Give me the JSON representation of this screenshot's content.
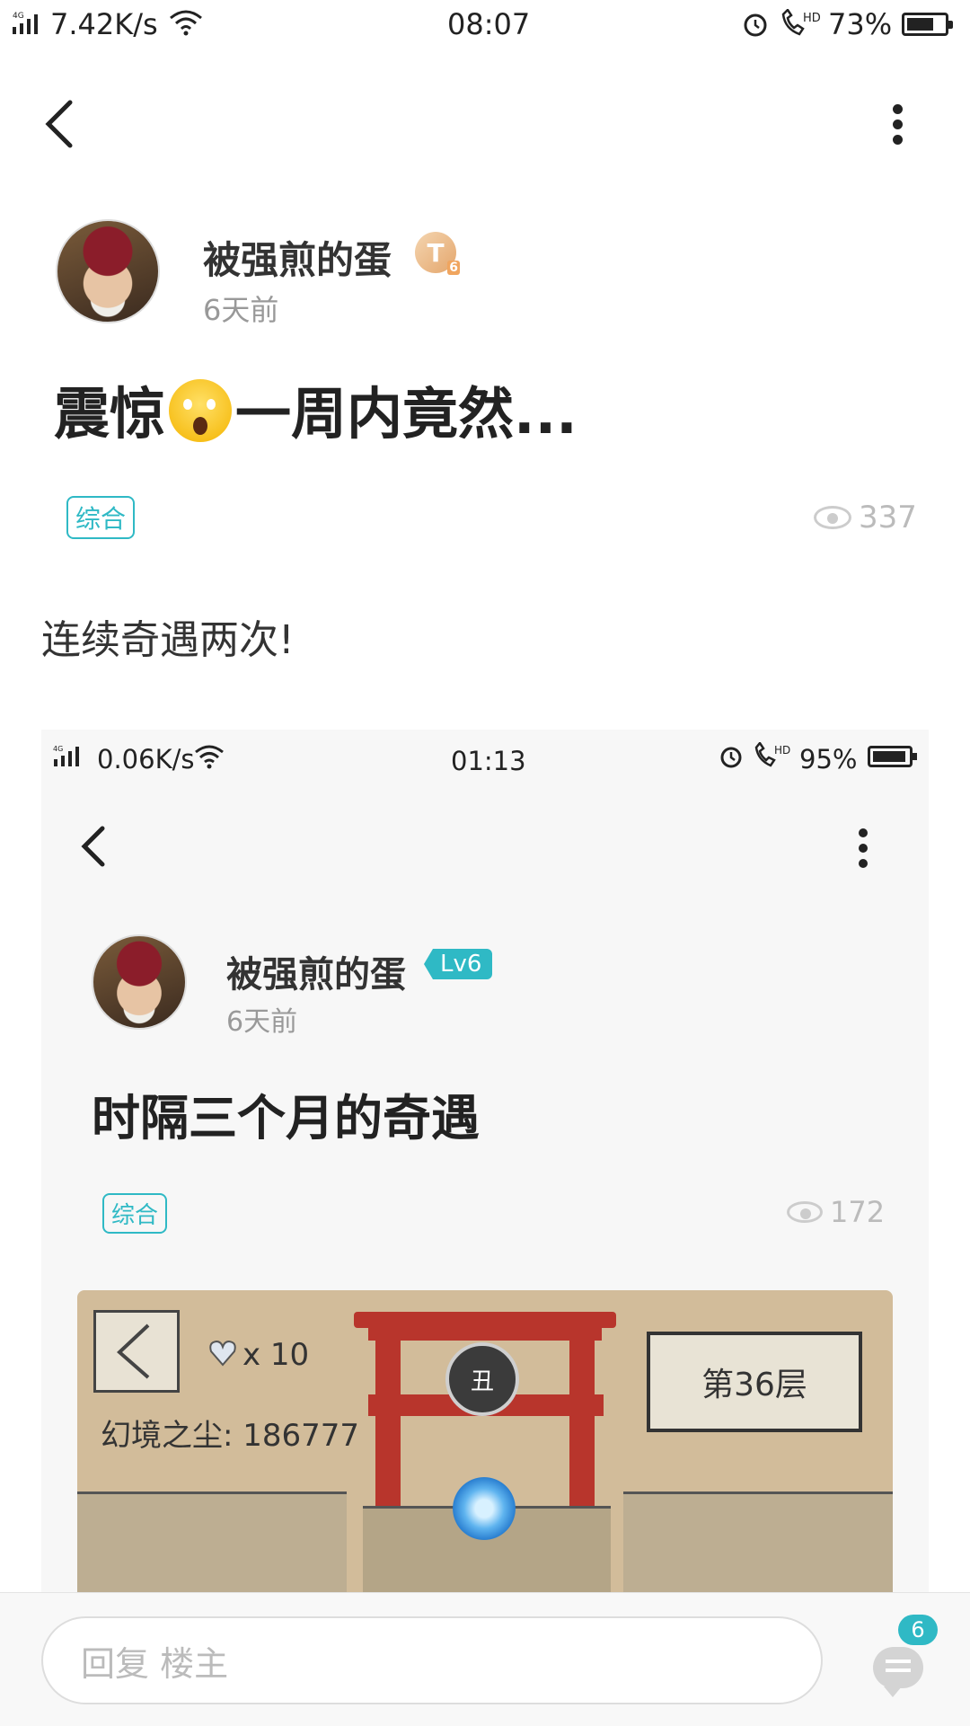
{
  "status_bar": {
    "network": "7.42K/s",
    "time": "08:07",
    "battery": "73%",
    "battery_level": 0.73
  },
  "header": {
    "back_icon": "chevron-left-icon",
    "more_icon": "more-vertical-icon"
  },
  "post": {
    "author": "被强煎的蛋",
    "author_badge": "T",
    "author_badge_level": "6",
    "time": "6天前",
    "title_before": "震惊",
    "title_emoji": "scream-emoji",
    "title_after": "一周内竟然...",
    "tag": "综合",
    "views": "337",
    "content": "连续奇遇两次!"
  },
  "embedded_screenshot": {
    "status_bar": {
      "network": "0.06K/s",
      "time": "01:13",
      "battery": "95%",
      "battery_level": 0.95
    },
    "author": "被强煎的蛋",
    "level": "Lv6",
    "time": "6天前",
    "title": "时隔三个月的奇遇",
    "tag": "综合",
    "views": "172",
    "game": {
      "hearts": "x 10",
      "dust": "幻境之尘: 186777",
      "floor": "第36层",
      "moon_label": "丑"
    }
  },
  "bottom_bar": {
    "reply_placeholder": "回复  楼主",
    "comment_count": "6"
  },
  "colors": {
    "accent": "#2fb9c5",
    "torii": "#b8352c"
  }
}
